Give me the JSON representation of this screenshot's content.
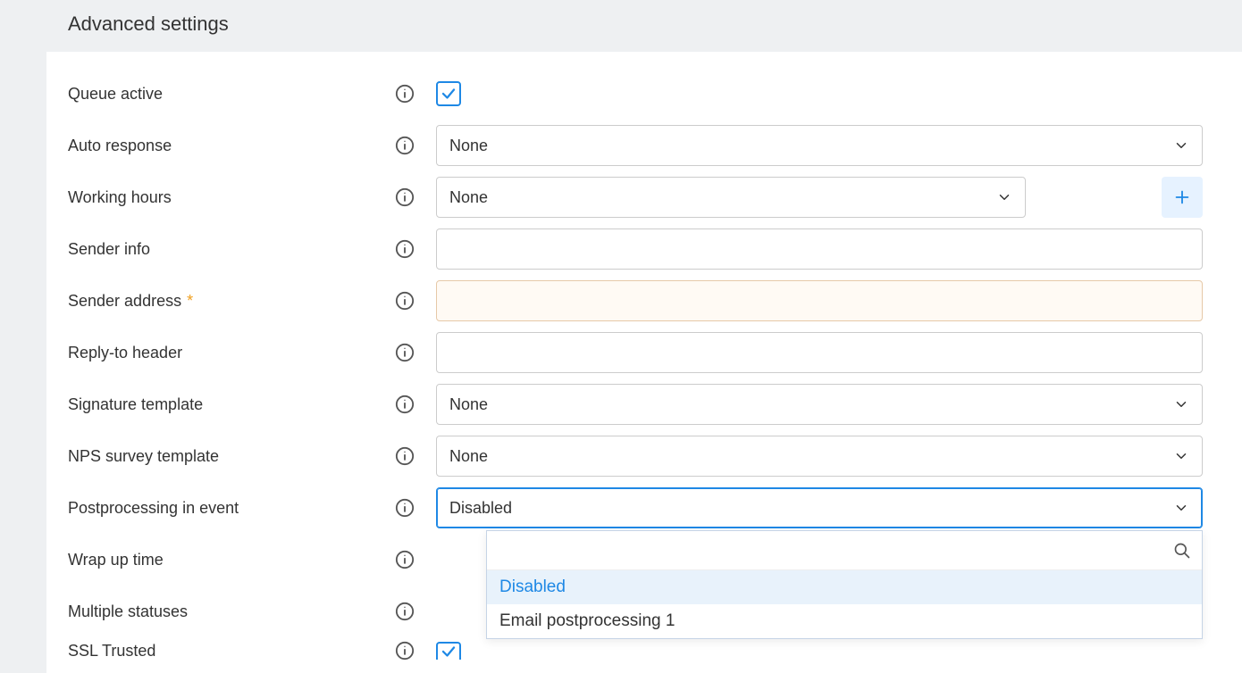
{
  "header": {
    "title": "Advanced settings"
  },
  "fields": {
    "queue_active": {
      "label": "Queue active",
      "checked": true
    },
    "auto_response": {
      "label": "Auto response",
      "value": "None"
    },
    "working_hours": {
      "label": "Working hours",
      "value": "None"
    },
    "sender_info": {
      "label": "Sender info",
      "value": ""
    },
    "sender_address": {
      "label": "Sender address",
      "required": true,
      "value": ""
    },
    "reply_to": {
      "label": "Reply-to header",
      "value": ""
    },
    "signature": {
      "label": "Signature template",
      "value": "None"
    },
    "nps": {
      "label": "NPS survey template",
      "value": "None"
    },
    "postprocessing": {
      "label": "Postprocessing in event",
      "value": "Disabled",
      "options": [
        "Disabled",
        "Email postprocessing 1"
      ],
      "open": true
    },
    "wrap_up": {
      "label": "Wrap up time"
    },
    "multi_status": {
      "label": "Multiple statuses"
    },
    "ssl": {
      "label": "SSL Trusted",
      "checked": true
    }
  }
}
